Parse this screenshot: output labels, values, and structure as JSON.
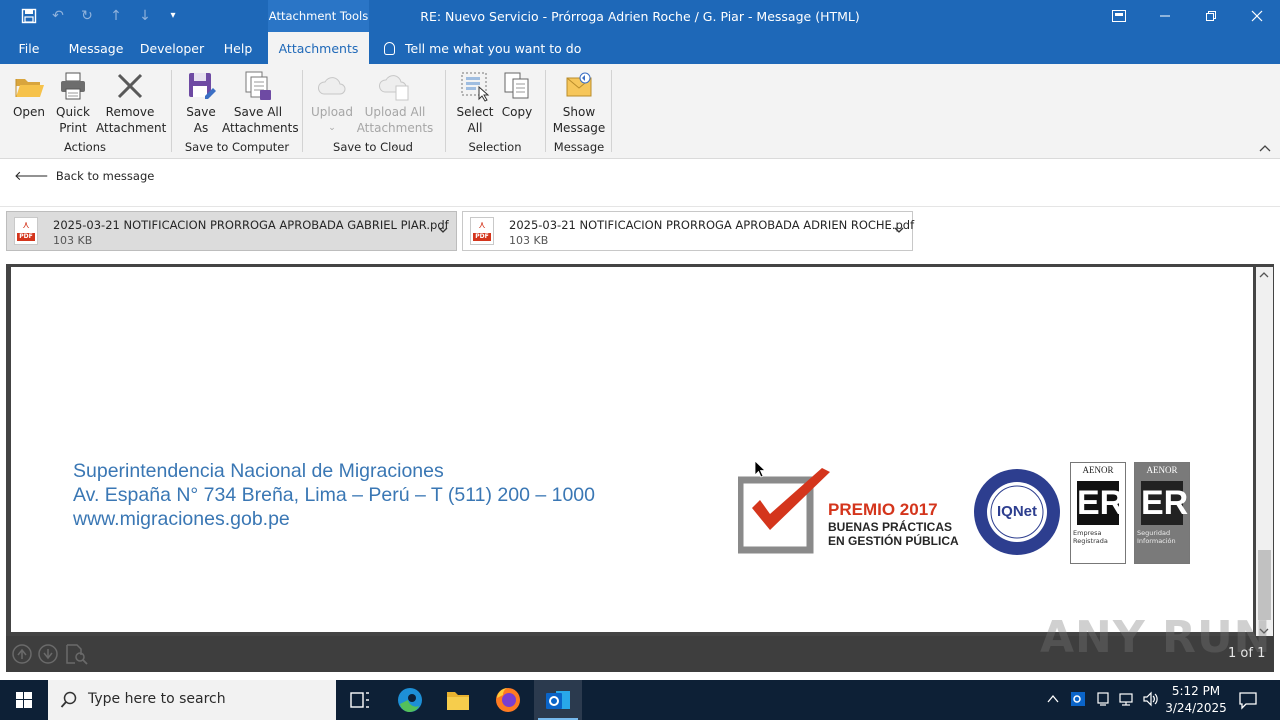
{
  "window": {
    "title": "RE: Nuevo Servicio - Prórroga Adrien Roche / G. Piar  -  Message (HTML)",
    "contextual_tab": "Attachment Tools"
  },
  "tabs": [
    "File",
    "Message",
    "Developer",
    "Help",
    "Attachments"
  ],
  "active_tab": "Attachments",
  "tell_me": "Tell me what you want to do",
  "ribbon": {
    "actions": {
      "open": "Open",
      "quick_print_1": "Quick",
      "quick_print_2": "Print",
      "remove_1": "Remove",
      "remove_2": "Attachment",
      "group": "Actions"
    },
    "save_computer": {
      "save_as_1": "Save",
      "save_as_2": "As",
      "save_all_1": "Save All",
      "save_all_2": "Attachments",
      "group": "Save to Computer"
    },
    "save_cloud": {
      "upload": "Upload",
      "upload_all_1": "Upload All",
      "upload_all_2": "Attachments",
      "group": "Save to Cloud"
    },
    "selection": {
      "select_all_1": "Select",
      "select_all_2": "All",
      "copy": "Copy",
      "group": "Selection"
    },
    "message": {
      "show_1": "Show",
      "show_2": "Message",
      "group": "Message"
    }
  },
  "back_label": "Back to message",
  "attachments": [
    {
      "name": "2025-03-21 NOTIFICACION PRORROGA APROBADA GABRIEL PIAR.pdf",
      "size": "103 KB",
      "selected": true
    },
    {
      "name": "2025-03-21 NOTIFICACION PRORROGA APROBADA ADRIEN ROCHE.pdf",
      "size": "103 KB",
      "selected": false
    }
  ],
  "document": {
    "line1": "Superintendencia Nacional de Migraciones",
    "line2": "Av. España N° 734 Breña, Lima – Perú – T (511) 200 – 1000",
    "line3": "www.migraciones.gob.pe",
    "premio_1": "PREMIO 2017",
    "premio_2": "BUENAS PRÁCTICAS",
    "premio_3": "EN GESTIÓN PÚBLICA",
    "iqnet": "IQNet",
    "aenor_1": "AENOR",
    "aenor_1_sub": "Empresa Registrada",
    "aenor_2": "AENOR",
    "aenor_2_sub": "Seguridad Información"
  },
  "preview": {
    "pager": "1 of 1"
  },
  "taskbar": {
    "search_placeholder": "Type here to search",
    "time": "5:12 PM",
    "date": "3/24/2025"
  },
  "watermark": "ANY RUN",
  "colors": {
    "accent": "#1e68b8",
    "signature": "#3a77b4",
    "premio_red": "#d4351c"
  }
}
